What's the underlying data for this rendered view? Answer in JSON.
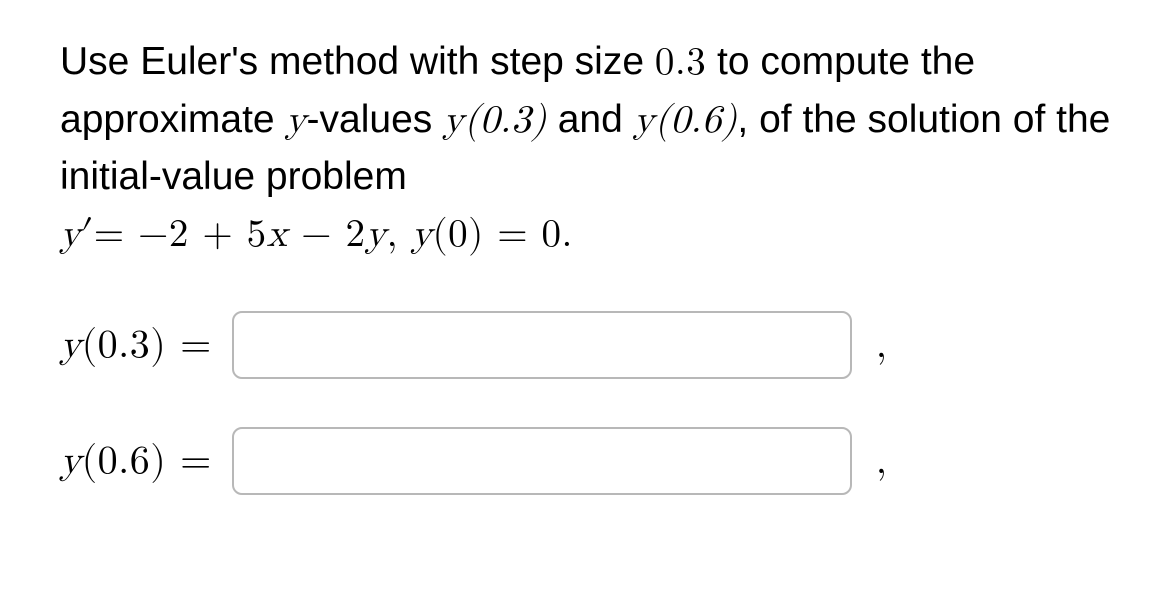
{
  "problem": {
    "sentence_parts": {
      "t1": "Use Euler's method with step size ",
      "step_size": "0.3",
      "t2": " to compute the approximate ",
      "yword": "y",
      "t3": "-values ",
      "yv1": "y(0.3)",
      "t4": " and ",
      "yv2": "y(0.6)",
      "t5": ", of the solution of the initial-value problem"
    },
    "equation": {
      "lhs_var": "y",
      "lhs_prime": "′",
      "eq1": "= ",
      "rhs1": "−2 + 5",
      "rhs_x": "x",
      "rhs2": " − 2",
      "rhs_y": "y",
      "sep": ",   ",
      "ic_y": "y",
      "ic_arg": "(0) = 0.",
      "trailing": ""
    }
  },
  "answers": [
    {
      "label_y": "y",
      "label_arg": "(0.3) = ",
      "value": ""
    },
    {
      "label_y": "y",
      "label_arg": "(0.6) = ",
      "value": ""
    }
  ],
  "comma": ","
}
